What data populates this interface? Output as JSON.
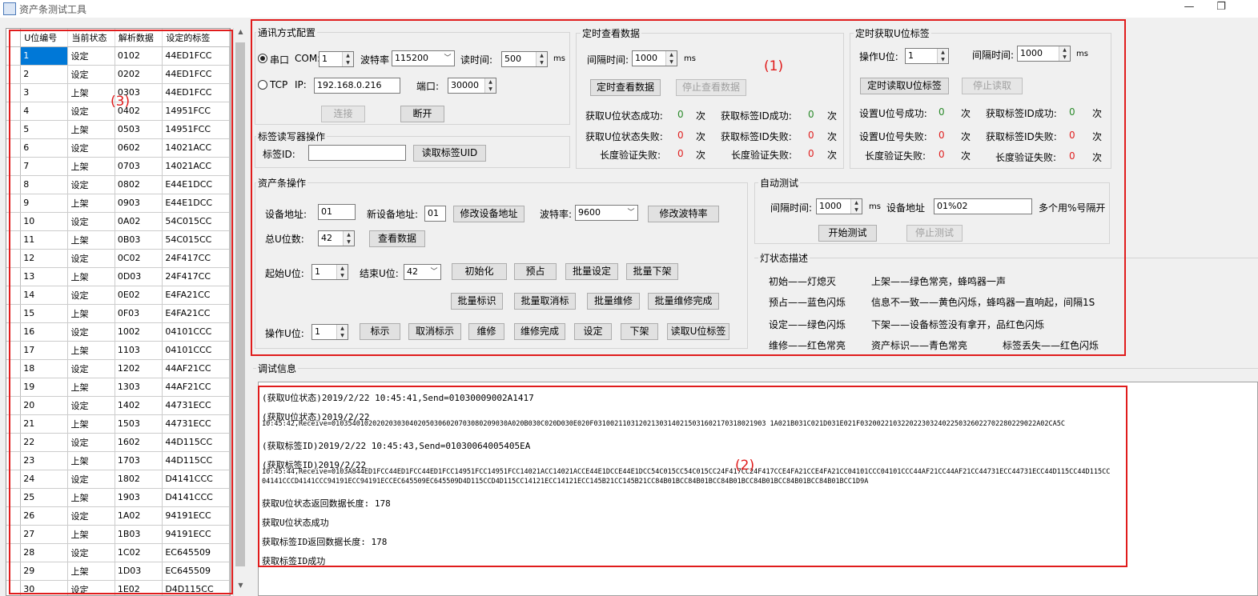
{
  "window": {
    "title": "资产条测试工具",
    "min": "—",
    "max": "❐"
  },
  "grid": {
    "headers": [
      "U位编号",
      "当前状态",
      "解析数据",
      "设定的标签"
    ],
    "rows": [
      [
        "1",
        "设定",
        "0102",
        "44ED1FCC"
      ],
      [
        "2",
        "设定",
        "0202",
        "44ED1FCC"
      ],
      [
        "3",
        "上架",
        "0303",
        "44ED1FCC"
      ],
      [
        "4",
        "设定",
        "0402",
        "14951FCC"
      ],
      [
        "5",
        "上架",
        "0503",
        "14951FCC"
      ],
      [
        "6",
        "设定",
        "0602",
        "14021ACC"
      ],
      [
        "7",
        "上架",
        "0703",
        "14021ACC"
      ],
      [
        "8",
        "设定",
        "0802",
        "E44E1DCC"
      ],
      [
        "9",
        "上架",
        "0903",
        "E44E1DCC"
      ],
      [
        "10",
        "设定",
        "0A02",
        "54C015CC"
      ],
      [
        "11",
        "上架",
        "0B03",
        "54C015CC"
      ],
      [
        "12",
        "设定",
        "0C02",
        "24F417CC"
      ],
      [
        "13",
        "上架",
        "0D03",
        "24F417CC"
      ],
      [
        "14",
        "设定",
        "0E02",
        "E4FA21CC"
      ],
      [
        "15",
        "上架",
        "0F03",
        "E4FA21CC"
      ],
      [
        "16",
        "设定",
        "1002",
        "04101CCC"
      ],
      [
        "17",
        "上架",
        "1103",
        "04101CCC"
      ],
      [
        "18",
        "设定",
        "1202",
        "44AF21CC"
      ],
      [
        "19",
        "上架",
        "1303",
        "44AF21CC"
      ],
      [
        "20",
        "设定",
        "1402",
        "44731ECC"
      ],
      [
        "21",
        "上架",
        "1503",
        "44731ECC"
      ],
      [
        "22",
        "设定",
        "1602",
        "44D115CC"
      ],
      [
        "23",
        "上架",
        "1703",
        "44D115CC"
      ],
      [
        "24",
        "设定",
        "1802",
        "D4141CCC"
      ],
      [
        "25",
        "上架",
        "1903",
        "D4141CCC"
      ],
      [
        "26",
        "设定",
        "1A02",
        "94191ECC"
      ],
      [
        "27",
        "上架",
        "1B03",
        "94191ECC"
      ],
      [
        "28",
        "设定",
        "1C02",
        "EC645509"
      ],
      [
        "29",
        "上架",
        "1D03",
        "EC645509"
      ],
      [
        "30",
        "设定",
        "1E02",
        "D4D115CC"
      ]
    ]
  },
  "comm": {
    "title": "通讯方式配置",
    "serial_label": "串口",
    "com_label": "COM:",
    "com_value": "1",
    "baud_label": "波特率",
    "baud_value": "115200",
    "read_time_label": "读时间:",
    "read_time_value": "500",
    "ms": "ms",
    "tcp_label": "TCP",
    "ip_label": "IP:",
    "ip_value": "192.168.0.216",
    "port_label": "端口:",
    "port_value": "30000",
    "connect": "连接",
    "disconnect": "断开"
  },
  "tag_rw": {
    "title": "标签读写器操作",
    "tag_id_label": "标签ID:",
    "tag_id_value": "",
    "read_uid": "读取标签UID"
  },
  "timer_view": {
    "title": "定时查看数据",
    "interval_label": "间隔时间:",
    "interval_value": "1000",
    "ms": "ms",
    "start": "定时查看数据",
    "stop": "停止查看数据",
    "s_ok_label": "获取U位状态成功:",
    "s_ok": "0",
    "id_ok_label": "获取标签ID成功:",
    "id_ok": "0",
    "s_fail_label": "获取U位状态失败:",
    "s_fail": "0",
    "id_fail_label": "获取标签ID失败:",
    "id_fail": "0",
    "len_fail_label": "长度验证失败:",
    "len_fail1": "0",
    "len_fail_label2": "长度验证失败:",
    "len_fail2": "0",
    "times": "次"
  },
  "timer_tag": {
    "title": "定时获取U位标签",
    "op_label": "操作U位:",
    "op_value": "1",
    "interval_label": "间隔时间:",
    "interval_value": "1000",
    "ms": "ms",
    "start": "定时读取U位标签",
    "stop": "停止读取",
    "set_ok_label": "设置U位号成功:",
    "set_ok": "0",
    "id_ok_label": "获取标签ID成功:",
    "id_ok": "0",
    "set_fail_label": "设置U位号失败:",
    "set_fail": "0",
    "id_fail_label": "获取标签ID失败:",
    "id_fail": "0",
    "len_fail_label": "长度验证失败:",
    "len_fail1": "0",
    "len_fail_label2": "长度验证失败:",
    "len_fail2": "0",
    "times": "次"
  },
  "asset": {
    "title": "资产条操作",
    "dev_addr_label": "设备地址:",
    "dev_addr": "01",
    "new_addr_label": "新设备地址:",
    "new_addr": "01",
    "modify_addr": "修改设备地址",
    "baud_label": "波特率:",
    "baud_value": "9600",
    "modify_baud": "修改波特率",
    "total_u_label": "总U位数:",
    "total_u": "42",
    "view_data": "查看数据",
    "start_u_label": "起始U位:",
    "start_u": "1",
    "end_u_label": "结束U位:",
    "end_u": "42",
    "init": "初始化",
    "preoccupy": "预占",
    "batch_set": "批量设定",
    "batch_off": "批量下架",
    "batch_mark": "批量标识",
    "batch_unmark": "批量取消标",
    "batch_repair": "批量维修",
    "batch_repair_done": "批量维修完成",
    "op_u_label": "操作U位:",
    "op_u": "1",
    "mark": "标示",
    "unmark": "取消标示",
    "repair": "维修",
    "repair_done": "维修完成",
    "set": "设定",
    "off": "下架",
    "read_tag": "读取U位标签"
  },
  "auto": {
    "title": "自动测试",
    "interval_label": "间隔时间:",
    "interval_value": "1000",
    "ms": "ms",
    "dev_label": "设备地址",
    "dev_value": "01%02",
    "hint": "多个用%号隔开",
    "start": "开始测试",
    "stop": "停止测试"
  },
  "lamp": {
    "title": "灯状态描述",
    "items": [
      "初始——灯熄灭",
      "上架——绿色常亮，蜂鸣器一声",
      "预占——蓝色闪烁",
      "信息不一致——黄色闪烁，蜂鸣器一直响起，间隔1S",
      "设定——绿色闪烁",
      "下架——设备标签没有拿开，品红色闪烁",
      "维修——红色常亮",
      "资产标识——青色常亮",
      "标签丢失——红色闪烁"
    ]
  },
  "debug": {
    "title": "调试信息",
    "lines": [
      "(获取U位状态)2019/2/22 10:45:41,Send=01030009002A1417",
      "(获取U位状态)2019/2/22",
      "10:45:42,Receive=0103540102020203030402050306020703080209030A020B030C020D030E020F031002110312021303140215031602170318021903 1A021B031C021D031E021F0320022103220223032402250326022702280229022A02CA5C",
      "(获取标签ID)2019/2/22 10:45:43,Send=01030064005405EA",
      "(获取标签ID)2019/2/22",
      "10:45:44,Receive=0103A844ED1FCC44ED1FCC44ED1FCC14951FCC14951FCC14021ACC14021ACCE44E1DCCE44E1DCC54C015CC54C015CC24F417CC24F417CCE4FA21CCE4FA21CC04101CCC04101CCC44AF21CC44AF21CC44731ECC44731ECC44D115CC44D115CC",
      "04141CCCD4141CCC94191ECC94191ECCEC645509EC645509D4D115CCD4D115CC14121ECC14121ECC145B21CC145B21CC84B01BCC84B01BCC84B01BCC84B01BCC84B01BCC84B01BCC1D9A",
      "获取U位状态返回数据长度: 178",
      "获取U位状态成功",
      "获取标签ID返回数据长度: 178",
      "获取标签ID成功"
    ]
  },
  "annotations": {
    "a1": "(1)",
    "a2": "(2)",
    "a3": "(3)"
  }
}
